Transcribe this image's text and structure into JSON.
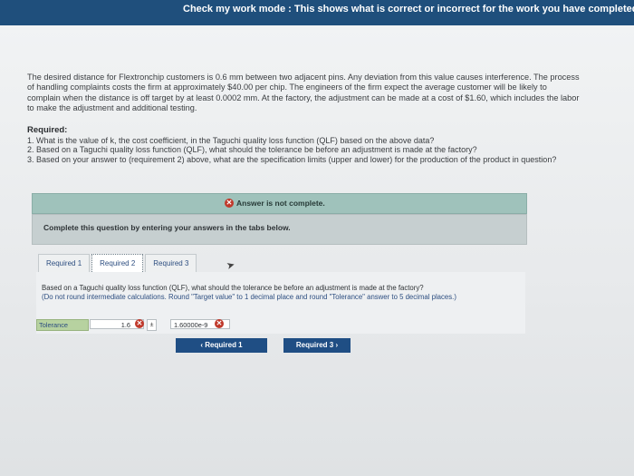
{
  "header": {
    "banner": "Check my work mode : This shows what is correct or incorrect for the work you have completed so far. It d"
  },
  "problem": {
    "text": "The desired distance for Flextronchip customers is 0.6 mm between two adjacent pins. Any deviation from this value causes interference. The process of handling complaints costs the firm at approximately $40.00 per chip. The engineers of the firm expect the average customer will be likely to complain when the distance is off target by at least 0.0002 mm. At the factory, the adjustment can be made at a cost of $1.60, which includes the labor to make the adjustment and additional testing."
  },
  "required": {
    "heading": "Required:",
    "items": [
      "1. What is the value of k, the cost coefficient, in the Taguchi quality loss function (QLF) based on the above data?",
      "2. Based on a Taguchi quality loss function (QLF), what should the tolerance be before an adjustment is made at the factory?",
      "3. Based on your answer to (requirement 2) above, what are the specification limits (upper and lower) for the production of the product in question?"
    ]
  },
  "status": {
    "message": "Answer is not complete.",
    "icon": "x-circle-icon",
    "color": "#c0392b"
  },
  "instructions": {
    "text": "Complete this question by entering your answers in the tabs below."
  },
  "tabs": [
    {
      "label": "Required 1"
    },
    {
      "label": "Required 2"
    },
    {
      "label": "Required 3"
    }
  ],
  "question": {
    "text": "Based on a Taguchi quality loss function (QLF), what should the tolerance be before an adjustment is made at the factory?",
    "note": "(Do not round intermediate calculations. Round \"Target value\" to 1 decimal place and round \"Tolerance\" answer to 5 decimal places.)"
  },
  "answer": {
    "label": "Tolerance",
    "target_value": "1.6",
    "plus_minus": "±",
    "tolerance_value": "1.60000e-9"
  },
  "navigation": {
    "prev_label": "Required 1",
    "next_label": "Required 3"
  }
}
